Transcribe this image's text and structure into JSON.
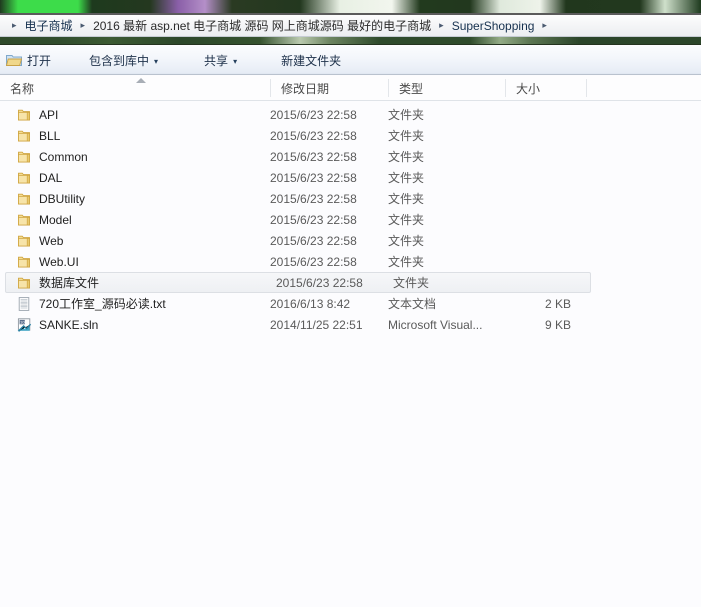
{
  "window": {
    "title": "SuperShopping"
  },
  "breadcrumb": {
    "name": "address-bar",
    "separator": "▸",
    "items": [
      {
        "label": "电子商城"
      },
      {
        "label": "2016 最新 asp.net 电子商城 源码 网上商城源码 最好的电子商城"
      },
      {
        "label": "SuperShopping"
      }
    ]
  },
  "toolbar": {
    "open_label": "打开",
    "include_library_label": "包含到库中",
    "share_label": "共享",
    "new_folder_label": "新建文件夹",
    "caret": "▾"
  },
  "columns": {
    "name": "名称",
    "date_modified": "修改日期",
    "type": "类型",
    "size": "大小",
    "sort_indicator": "ascending"
  },
  "files": [
    {
      "name": "API",
      "icon": "folder-icon",
      "date": "2015/6/23 22:58",
      "type": "文件夹",
      "size": "",
      "selected": false
    },
    {
      "name": "BLL",
      "icon": "folder-icon",
      "date": "2015/6/23 22:58",
      "type": "文件夹",
      "size": "",
      "selected": false
    },
    {
      "name": "Common",
      "icon": "folder-icon",
      "date": "2015/6/23 22:58",
      "type": "文件夹",
      "size": "",
      "selected": false
    },
    {
      "name": "DAL",
      "icon": "folder-icon",
      "date": "2015/6/23 22:58",
      "type": "文件夹",
      "size": "",
      "selected": false
    },
    {
      "name": "DBUtility",
      "icon": "folder-icon",
      "date": "2015/6/23 22:58",
      "type": "文件夹",
      "size": "",
      "selected": false
    },
    {
      "name": "Model",
      "icon": "folder-icon",
      "date": "2015/6/23 22:58",
      "type": "文件夹",
      "size": "",
      "selected": false
    },
    {
      "name": "Web",
      "icon": "folder-icon",
      "date": "2015/6/23 22:58",
      "type": "文件夹",
      "size": "",
      "selected": false
    },
    {
      "name": "Web.UI",
      "icon": "folder-icon",
      "date": "2015/6/23 22:58",
      "type": "文件夹",
      "size": "",
      "selected": false
    },
    {
      "name": "数据库文件",
      "icon": "folder-icon",
      "date": "2015/6/23 22:58",
      "type": "文件夹",
      "size": "",
      "selected": true
    },
    {
      "name": "720工作室_源码必读.txt",
      "icon": "text-file-icon",
      "date": "2016/6/13 8:42",
      "type": "文本文档",
      "size": "2 KB",
      "selected": false
    },
    {
      "name": "SANKE.sln",
      "icon": "solution-file-icon",
      "date": "2014/11/25 22:51",
      "type": "Microsoft Visual...",
      "size": "9 KB",
      "selected": false
    }
  ],
  "colors": {
    "folder_body": "#f3d98a",
    "folder_edge": "#d8ab46",
    "green_band": "#2f4a2b",
    "selection_bg": "#f1f3f6",
    "text_primary": "#1f1f1f",
    "text_secondary": "#5a5a5a",
    "breadcrumb_text": "#16314f"
  }
}
